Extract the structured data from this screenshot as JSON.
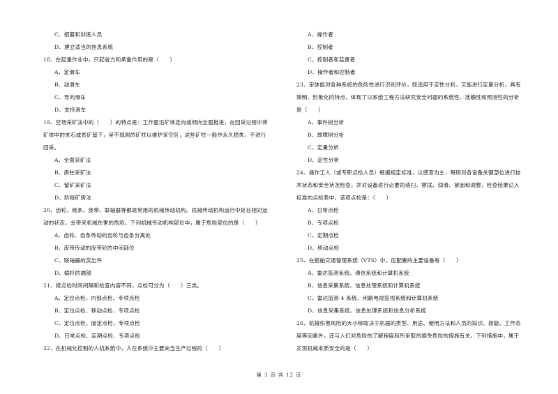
{
  "left_column": [
    {
      "type": "option",
      "text": "C、招募和训练人员"
    },
    {
      "type": "option",
      "text": "D、建立适当的信息系统"
    },
    {
      "type": "question",
      "text": "18、在起重作业中，只起省力和承重作用的是（　　）"
    },
    {
      "type": "option",
      "text": "A、定滑车"
    },
    {
      "type": "option",
      "text": "B、动滑车"
    },
    {
      "type": "option",
      "text": "C、导向滑车"
    },
    {
      "type": "option",
      "text": "D、支持滑车"
    },
    {
      "type": "question",
      "text": "19、空场采矿法中的（　　）的特点是：工作面沿矿体走向或倾向全面推进，在回采过程中将"
    },
    {
      "type": "question",
      "text": "矿体中的夹石或贫矿留下，呈不规则的矿柱以维护采空区，这些矿柱一般作永久损失，不进行"
    },
    {
      "type": "question",
      "text": "回采。"
    },
    {
      "type": "option",
      "text": "A、全面采矿法"
    },
    {
      "type": "option",
      "text": "B、房柱采矿法"
    },
    {
      "type": "option",
      "text": "C、留矿采矿法"
    },
    {
      "type": "option",
      "text": "D、阶段矿房法"
    },
    {
      "type": "question",
      "text": "20、齿轮、链条、皮带、联轴器等都是常用的机械传动机构。机械传动机构运行中处在相对运"
    },
    {
      "type": "question",
      "text": "动的状态，会带来机械伤害的危险。下列机械传动机构部位中，属于危险部位的是（　　）"
    },
    {
      "type": "option",
      "text": "A、齿轮、齿条传动的齿轮与齿条分离处"
    },
    {
      "type": "option",
      "text": "B、皮带传动的皮带轮的中间部位"
    },
    {
      "type": "option",
      "text": "C、联轴器的突出件"
    },
    {
      "type": "option",
      "text": "D、蜗杆的端部"
    },
    {
      "type": "question",
      "text": "21、按点检时间间隔和检查内容不同，点检可分为（　　）三类。"
    },
    {
      "type": "option",
      "text": "A、定位点检、内部点检、专项点检"
    },
    {
      "type": "option",
      "text": "B、定位点检、移动点检、专项点检"
    },
    {
      "type": "option",
      "text": "C、定位点检、固定点检、专项点检"
    },
    {
      "type": "option",
      "text": "D、日常点检、定期点检、专项点检"
    },
    {
      "type": "question",
      "text": "22、在机械化控制的人机系统中，人在系统中主要充当生产过程的（　　）"
    }
  ],
  "right_column": [
    {
      "type": "option",
      "text": "A、操作者"
    },
    {
      "type": "option",
      "text": "B、控制者"
    },
    {
      "type": "option",
      "text": "C、控制者和监督者"
    },
    {
      "type": "option",
      "text": "D、操作者和控制者"
    },
    {
      "type": "question",
      "text": "23、宋体能对各种系统的危险性进行识别评价，既适用于定性分析，又能进行定量分析，具有"
    },
    {
      "type": "question",
      "text": "简明、形象化的特点，体现了以系统工程方法研究安全问题的系统性、准确性和预测性的分析"
    },
    {
      "type": "question",
      "text": "是（　　）"
    },
    {
      "type": "option",
      "text": "A、事件树分析"
    },
    {
      "type": "option",
      "text": "B、故障树分析"
    },
    {
      "type": "option",
      "text": "C、定量分析"
    },
    {
      "type": "option",
      "text": "D、定性分析"
    },
    {
      "type": "question",
      "text": "24、操作工人（或专职点检人员）根据规定标准，以感官为主，每班对各设备关键部位进行技"
    },
    {
      "type": "question",
      "text": "术状态和安全状况检查，并对设备进行必要的清扫、擦拭、润滑、紧固和调整，检查结果记入"
    },
    {
      "type": "question",
      "text": "标准的点检表中，该项点检是：（　　）"
    },
    {
      "type": "option",
      "text": "A、日常点检"
    },
    {
      "type": "option",
      "text": "B、专项点检"
    },
    {
      "type": "option",
      "text": "C、定期点检"
    },
    {
      "type": "option",
      "text": "D、移动点检"
    },
    {
      "type": "question",
      "text": "25、在船舶交通管理系统（VTS）中，应配置的主要设备有（　　）"
    },
    {
      "type": "option",
      "text": "A、雷达监测系统、通信系统和计算机系统"
    },
    {
      "type": "option",
      "text": "B、信息采集系统、信息处理系统和计算机系统"
    },
    {
      "type": "option",
      "text": "C、雷达监测 4 系统、闭路电视监视系统和计算机系统"
    },
    {
      "type": "option",
      "text": "D、信息采集系统、信息处理系统和信息分析系统"
    },
    {
      "type": "question",
      "text": "26、机械伤害风险的大小除取决于机器的类型、用途、使用方法和人员的知识、技能、工作态"
    },
    {
      "type": "question",
      "text": "度等因素外，还与人们对危险的了解程度和所采取的避免危险的措施有关。下列措施中，属于"
    },
    {
      "type": "question",
      "text": "实现机械本质安全的是（　　）"
    }
  ],
  "footer": {
    "page_label": "第 3 页 共 12 页"
  }
}
